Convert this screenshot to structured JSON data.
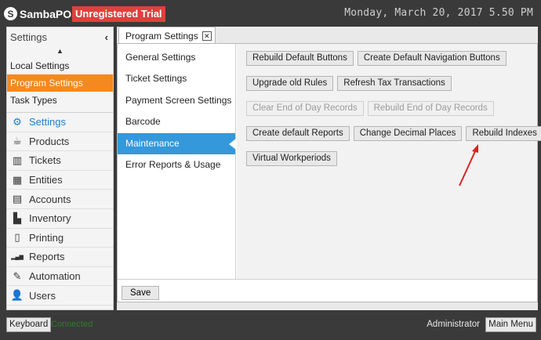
{
  "app": {
    "brand": "SambaPOS",
    "trial_badge": "Unregistered Trial",
    "clock": "Monday, March 20, 2017 5.50 PM"
  },
  "sidebar": {
    "header": "Settings",
    "collapse_glyph": "‹",
    "scroll_up_glyph": "▲",
    "sub_items": [
      {
        "label": "Local Settings",
        "active": false
      },
      {
        "label": "Program Settings",
        "active": true
      },
      {
        "label": "Task Types",
        "active": false
      }
    ],
    "main_items": [
      {
        "label": "Settings",
        "icon": "gear-icon",
        "glyph": "⚙",
        "active": true
      },
      {
        "label": "Products",
        "icon": "coffee-cup-icon",
        "glyph": "☕",
        "active": false
      },
      {
        "label": "Tickets",
        "icon": "books-icon",
        "glyph": "▥",
        "active": false
      },
      {
        "label": "Entities",
        "icon": "table-icon",
        "glyph": "▦",
        "active": false
      },
      {
        "label": "Accounts",
        "icon": "calculator-icon",
        "glyph": "▤",
        "active": false
      },
      {
        "label": "Inventory",
        "icon": "inventory-icon",
        "glyph": "▙",
        "active": false
      },
      {
        "label": "Printing",
        "icon": "document-icon",
        "glyph": "▯",
        "active": false
      },
      {
        "label": "Reports",
        "icon": "bar-chart-icon",
        "glyph": "▂▄▆",
        "active": false
      },
      {
        "label": "Automation",
        "icon": "pencil-icon",
        "glyph": "✎",
        "active": false
      },
      {
        "label": "Users",
        "icon": "user-icon",
        "glyph": "👤",
        "active": false
      }
    ]
  },
  "tab": {
    "label": "Program Settings",
    "close_glyph": "✕"
  },
  "settings_list": [
    {
      "label": "General Settings",
      "active": false
    },
    {
      "label": "Ticket Settings",
      "active": false
    },
    {
      "label": "Payment Screen Settings",
      "active": false
    },
    {
      "label": "Barcode",
      "active": false
    },
    {
      "label": "Maintenance",
      "active": true
    },
    {
      "label": "Error Reports & Usage",
      "active": false
    }
  ],
  "maintenance_buttons": [
    [
      {
        "label": "Rebuild Default Buttons",
        "enabled": true
      },
      {
        "label": "Create Default Navigation Buttons",
        "enabled": true
      }
    ],
    [
      {
        "label": "Upgrade old Rules",
        "enabled": true
      },
      {
        "label": "Refresh Tax Transactions",
        "enabled": true
      }
    ],
    [
      {
        "label": "Clear End of Day Records",
        "enabled": false
      },
      {
        "label": "Rebuild End of Day Records",
        "enabled": false
      }
    ],
    [
      {
        "label": "Create default Reports",
        "enabled": true
      },
      {
        "label": "Change Decimal Places",
        "enabled": true
      },
      {
        "label": "Rebuild Indexes",
        "enabled": true
      }
    ],
    [
      {
        "label": "Virtual Workperiods",
        "enabled": true
      }
    ]
  ],
  "save_label": "Save",
  "status": {
    "keyboard_label": "Keyboard",
    "connection": "Connected",
    "user": "Administrator",
    "main_menu_label": "Main Menu"
  },
  "colors": {
    "accent_orange": "#f5891f",
    "selection_blue": "#3498db",
    "trial_red": "#e0403c",
    "annotation_red": "#e02020"
  }
}
